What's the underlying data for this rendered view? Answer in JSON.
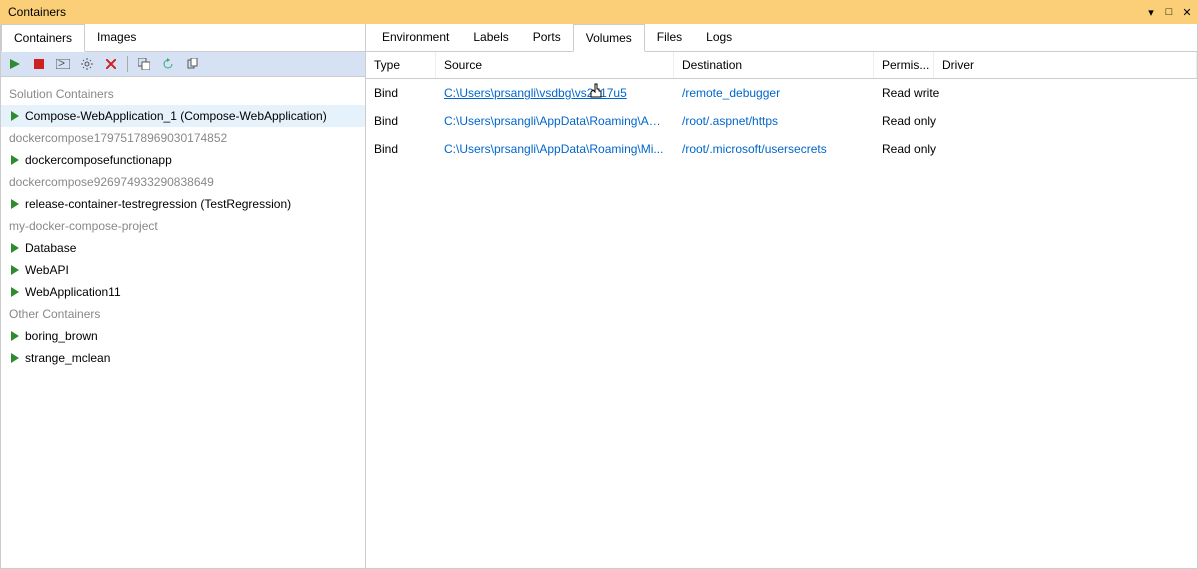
{
  "window": {
    "title": "Containers"
  },
  "leftTabs": {
    "containers": "Containers",
    "images": "Images"
  },
  "tree": {
    "groups": [
      {
        "label": "Solution Containers",
        "items": [
          {
            "label": "Compose-WebApplication_1 (Compose-WebApplication)",
            "selected": true
          }
        ]
      },
      {
        "label": "dockercompose17975178969030174852",
        "items": [
          {
            "label": "dockercomposefunctionapp"
          }
        ]
      },
      {
        "label": "dockercompose926974933290838649",
        "items": [
          {
            "label": "release-container-testregression (TestRegression)"
          }
        ]
      },
      {
        "label": "my-docker-compose-project",
        "items": [
          {
            "label": "Database"
          },
          {
            "label": "WebAPI"
          },
          {
            "label": "WebApplication11"
          }
        ]
      },
      {
        "label": "Other Containers",
        "items": [
          {
            "label": "boring_brown"
          },
          {
            "label": "strange_mclean"
          }
        ]
      }
    ]
  },
  "rightTabs": {
    "environment": "Environment",
    "labels": "Labels",
    "ports": "Ports",
    "volumes": "Volumes",
    "files": "Files",
    "logs": "Logs"
  },
  "grid": {
    "headers": {
      "type": "Type",
      "source": "Source",
      "destination": "Destination",
      "permissions": "Permis...",
      "driver": "Driver"
    },
    "rows": [
      {
        "type": "Bind",
        "source": "C:\\Users\\prsangli\\vsdbg\\vs2017u5",
        "sourceFull": true,
        "destination": "/remote_debugger",
        "permissions": "Read write",
        "driver": ""
      },
      {
        "type": "Bind",
        "source": "C:\\Users\\prsangli\\AppData\\Roaming\\AS...",
        "destination": "/root/.aspnet/https",
        "permissions": "Read only",
        "driver": ""
      },
      {
        "type": "Bind",
        "source": "C:\\Users\\prsangli\\AppData\\Roaming\\Mi...",
        "destination": "/root/.microsoft/usersecrets",
        "permissions": "Read only",
        "driver": ""
      }
    ]
  }
}
